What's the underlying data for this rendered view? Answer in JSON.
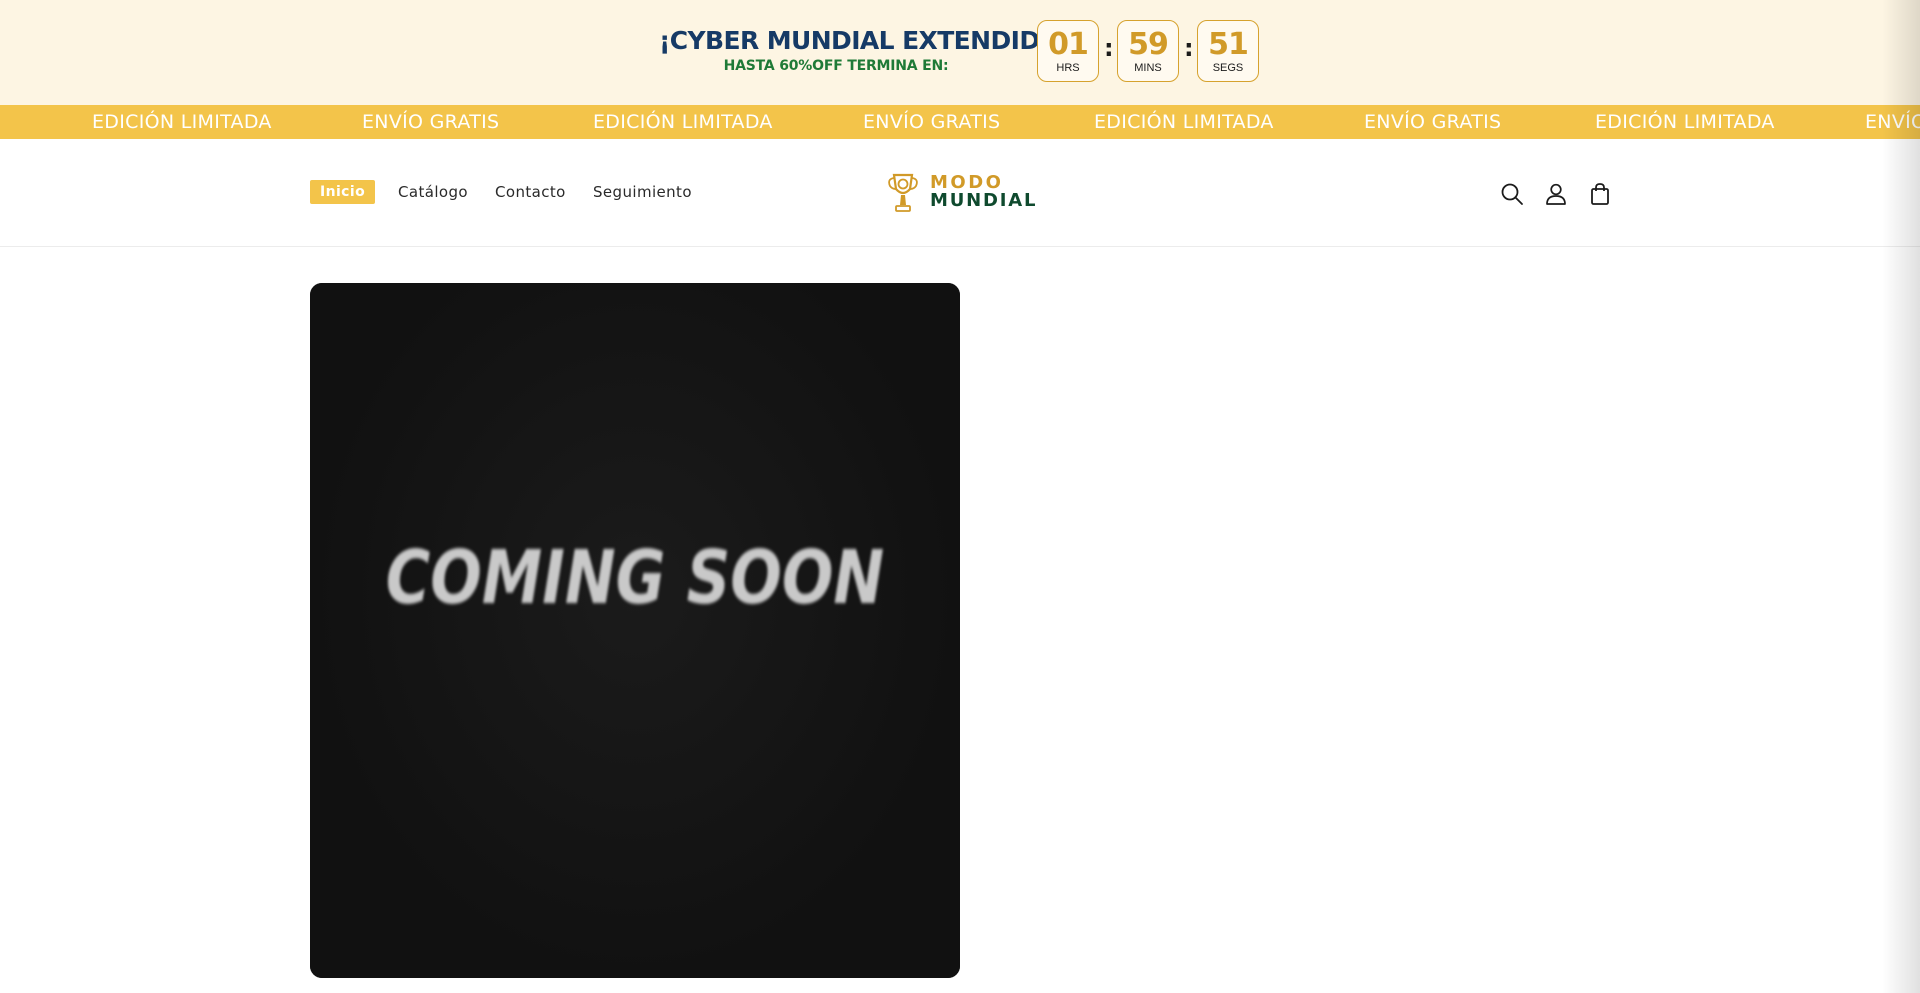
{
  "promo": {
    "title": "¡CYBER MUNDIAL EXTENDIDO!",
    "subtitle": "HASTA 60%OFF TERMINA EN:",
    "timer": {
      "hours": "01",
      "hours_label": "HRS",
      "minutes": "59",
      "minutes_label": "MINS",
      "seconds": "51",
      "seconds_label": "SEGS",
      "separator": ":"
    },
    "colors": {
      "background": "#fdf5e3",
      "title": "#163a66",
      "subtitle": "#1f7a37",
      "accent": "#d19a28"
    }
  },
  "marquee": {
    "items": [
      "EDICIÓN LIMITADA",
      "ENVÍO GRATIS",
      "EDICIÓN LIMITADA",
      "ENVÍO GRATIS",
      "EDICIÓN LIMITADA",
      "ENVÍO GRATIS",
      "EDICIÓN LIMITADA",
      "ENVÍO GRATIS"
    ],
    "background": "#f3c44a"
  },
  "header": {
    "nav": [
      {
        "label": "Inicio",
        "active": true
      },
      {
        "label": "Catálogo",
        "active": false
      },
      {
        "label": "Contacto",
        "active": false
      },
      {
        "label": "Seguimiento",
        "active": false
      }
    ],
    "logo": {
      "line1": "MODO",
      "line2": "MUNDIAL",
      "icon": "trophy-logo-icon"
    },
    "icons": [
      "search-icon",
      "account-icon",
      "cart-icon"
    ]
  },
  "main": {
    "media_text": "COMING SOON"
  }
}
